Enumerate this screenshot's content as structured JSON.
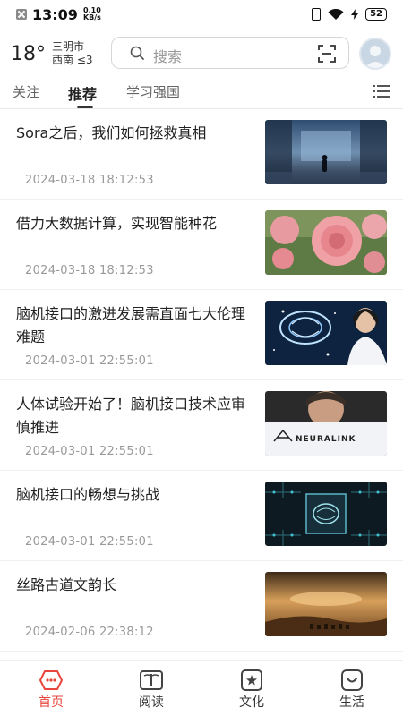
{
  "status_bar": {
    "time": "13:09",
    "net_speed_value": "0.10",
    "net_speed_unit": "KB/s",
    "battery": "52"
  },
  "header": {
    "temperature": "18°",
    "city": "三明市",
    "wind": "西南 ≤3",
    "search_placeholder": "搜索"
  },
  "tabs": [
    {
      "label": "关注"
    },
    {
      "label": "推荐"
    },
    {
      "label": "学习强国"
    }
  ],
  "news": [
    {
      "title": "Sora之后，我们如何拯救真相",
      "date": "2024-03-18 18:12:53",
      "thumb": "dark-figure-in-digital-city"
    },
    {
      "title": "借力大数据计算，实现智能种花",
      "date": "2024-03-18 18:12:53",
      "thumb": "pink-roses"
    },
    {
      "title": "脑机接口的激进发展需直面七大伦理难题",
      "date": "2024-03-01 22:55:01",
      "thumb": "glowing-brain-and-woman"
    },
    {
      "title": "人体试验开始了！脑机接口技术应审慎推进",
      "date": "2024-03-01 22:55:01",
      "thumb": "neuralink-logo"
    },
    {
      "title": "脑机接口的畅想与挑战",
      "date": "2024-03-01 22:55:01",
      "thumb": "brain-chip-circuit"
    },
    {
      "title": "丝路古道文韵长",
      "date": "2024-02-06 22:38:12",
      "thumb": "desert-camel-caravan"
    }
  ],
  "thumb_text": {
    "neuralink": "NEURALINK"
  },
  "bottom_nav": [
    {
      "label": "首页",
      "icon": "home-icon"
    },
    {
      "label": "阅读",
      "icon": "book-icon"
    },
    {
      "label": "文化",
      "icon": "culture-icon"
    },
    {
      "label": "生活",
      "icon": "life-icon"
    }
  ],
  "colors": {
    "accent": "#e8453c",
    "text": "#222222",
    "muted": "#999999"
  }
}
